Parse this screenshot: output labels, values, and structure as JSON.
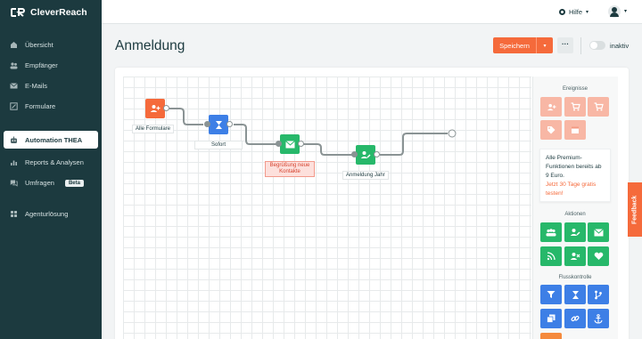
{
  "app": {
    "logo_text": "CleverReach"
  },
  "sidebar": {
    "items": [
      {
        "label": "Übersicht",
        "icon": "dashboard-icon"
      },
      {
        "label": "Empfänger",
        "icon": "users-icon"
      },
      {
        "label": "E-Mails",
        "icon": "mail-icon"
      },
      {
        "label": "Formulare",
        "icon": "form-icon"
      },
      {
        "label": "Automation THEA",
        "icon": "robot-icon",
        "active": true
      },
      {
        "label": "Reports & Analysen",
        "icon": "chart-icon"
      },
      {
        "label": "Umfragen",
        "icon": "chat-icon",
        "badge": "Beta"
      },
      {
        "label": "Agenturlösung",
        "icon": "grid-icon"
      }
    ]
  },
  "topbar": {
    "help_label": "Hilfe"
  },
  "page": {
    "title": "Anmeldung"
  },
  "toolbar": {
    "save_label": "Speichern",
    "more_label": "···",
    "toggle_label": "inaktiv",
    "toggle_on": false
  },
  "flow": {
    "nodes": [
      {
        "label": "Alle Formulare",
        "icon": "user-add-icon",
        "color": "#f56a3b"
      },
      {
        "label": "Sofort",
        "icon": "hourglass-icon",
        "color": "#3d7fe6"
      },
      {
        "label": "Begrüßung neue Kontakte",
        "icon": "mail-icon",
        "color": "#27b86a"
      },
      {
        "label": "Anmeldung Jahr",
        "icon": "user-edit-icon",
        "color": "#27b86a"
      }
    ]
  },
  "panel": {
    "events_title": "Ereignisse",
    "promo_text": "Alle Premium-Funktionen bereits ab 9 Euro.",
    "promo_link": "Jetzt 30 Tage gratis testen!",
    "actions_title": "Aktionen",
    "flow_title": "Flusskontrolle"
  },
  "feedback_label": "Feedback",
  "colors": {
    "sidebar_bg": "#1c3a3f",
    "accent": "#f56a3b",
    "green": "#27b86a",
    "blue": "#3d7fe6",
    "pink": "#f8b7a5"
  }
}
